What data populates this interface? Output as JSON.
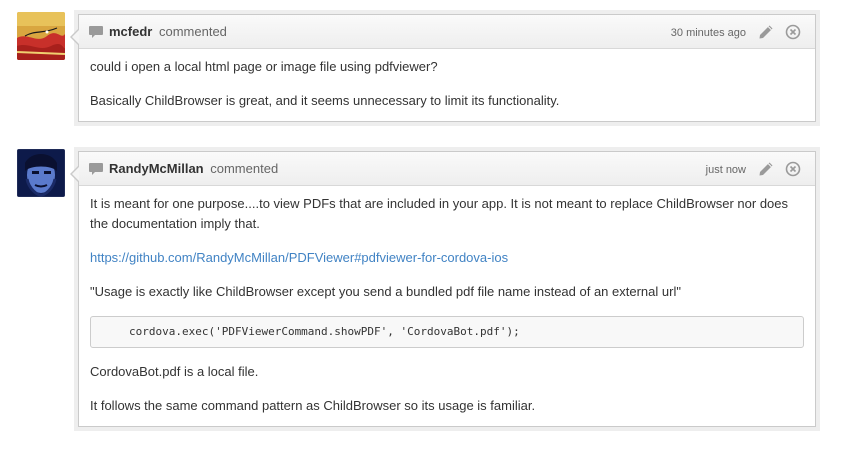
{
  "comments": [
    {
      "author": "mcfedr",
      "action": "commented",
      "timestamp": "30 minutes ago",
      "avatar_icon": "avatar-mcfedr",
      "paragraphs": [
        "could i open a local html page or image file using pdfviewer?",
        "Basically ChildBrowser is great, and it seems unnecessary to limit its functionality."
      ]
    },
    {
      "author": "RandyMcMillan",
      "action": "commented",
      "timestamp": "just now",
      "avatar_icon": "avatar-randymcmillan",
      "paragraphs": [
        "It is meant for one purpose....to view PDFs that are included in your app. It is not meant to replace ChildBrowser nor does the documentation imply that.",
        "https://github.com/RandyMcMillan/PDFViewer#pdfviewer-for-cordova-ios",
        "\"Usage is exactly like ChildBrowser except you send a bundled pdf file name instead of an external url\"",
        "cordova.exec('PDFViewerCommand.showPDF', 'CordovaBot.pdf');",
        "CordovaBot.pdf is a local file.",
        "It follows the same command pattern as ChildBrowser so its usage is familiar."
      ]
    }
  ],
  "icons": {
    "comment": "speech-bubble-icon",
    "edit": "pencil-icon",
    "delete": "close-circle-icon"
  },
  "colors": {
    "link": "#4183c4",
    "header_bg": "#eeeeee",
    "border": "#cacaca"
  }
}
